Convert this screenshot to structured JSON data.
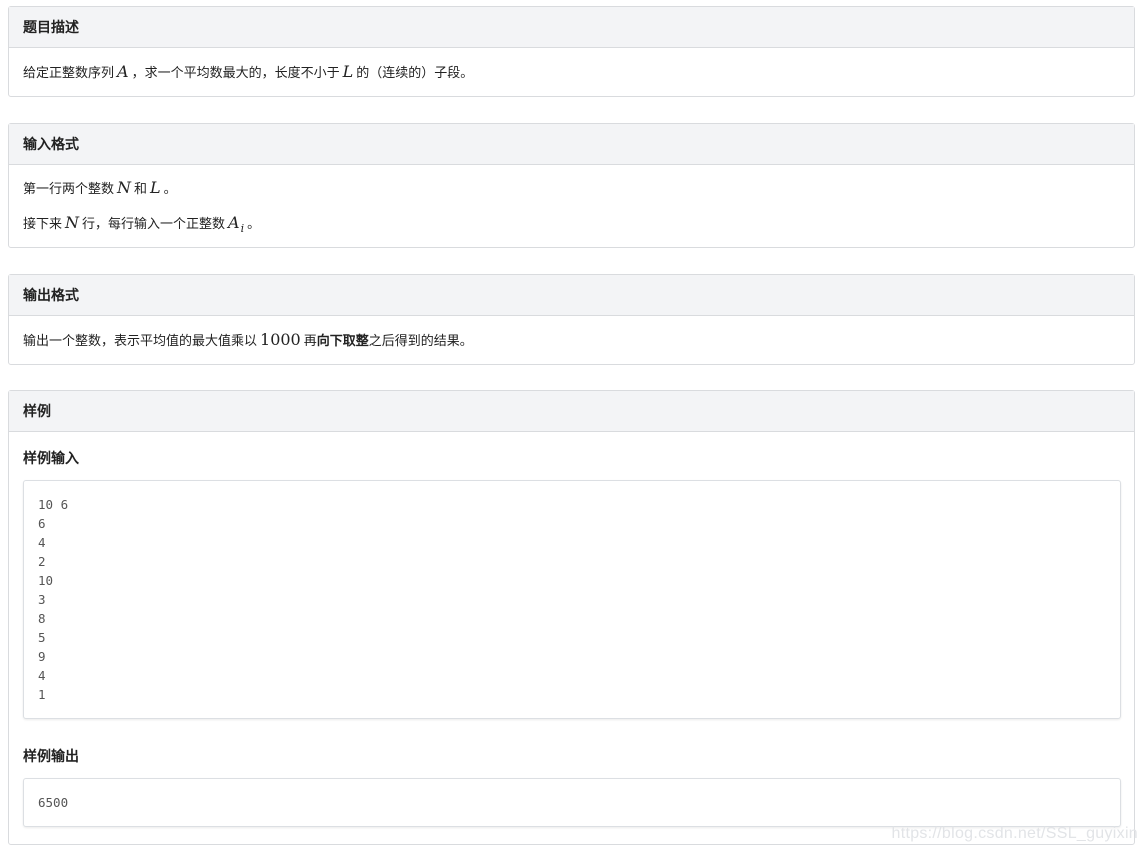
{
  "description": {
    "header": "题目描述",
    "text_a": "给定正整数序列",
    "var_a": "A",
    "text_b": "，求一个平均数最大的，长度不小于",
    "var_l": "L",
    "text_c": "的（连续的）子段。"
  },
  "input_format": {
    "header": "输入格式",
    "line1_a": "第一行两个整数",
    "line1_var_n": "N",
    "line1_b": "和",
    "line1_var_l": "L",
    "line1_c": "。",
    "line2_a": "接下来",
    "line2_var_n": "N",
    "line2_b": "行，每行输入一个正整数",
    "line2_var_a": "A",
    "line2_var_sub": "i",
    "line2_c": "。"
  },
  "output_format": {
    "header": "输出格式",
    "text_a": "输出一个整数，表示平均值的最大值乘以",
    "num": "1000",
    "text_b": "再",
    "text_bold": "向下取整",
    "text_c": "之后得到的结果。"
  },
  "sample": {
    "header": "样例",
    "input_label": "样例输入",
    "input_code": "10 6\n6\n4\n2\n10\n3\n8\n5\n9\n4\n1",
    "output_label": "样例输出",
    "output_code": "6500"
  },
  "watermark": "https://blog.csdn.net/SSL_guyixin"
}
